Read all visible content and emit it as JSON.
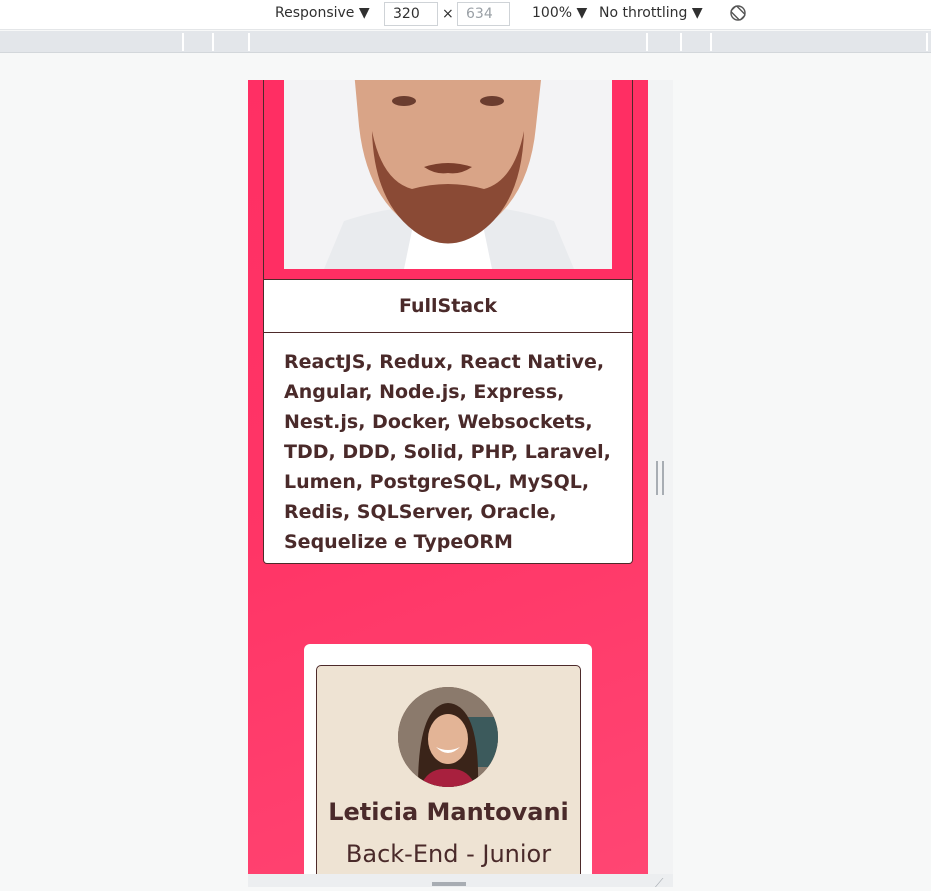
{
  "devtools": {
    "device": "Responsive",
    "width": "320",
    "height": "634",
    "zoom": "100%",
    "throttling": "No throttling"
  },
  "card1": {
    "role": "FullStack",
    "skills": "ReactJS, Redux, React Native, Angular, Node.js, Express, Nest.js, Docker, Websockets, TDD, DDD, Solid, PHP, Laravel, Lumen, PostgreSQL, MySQL, Redis, SQLServer, Oracle, Sequelize e TypeORM"
  },
  "card2": {
    "name": "Leticia Mantovani",
    "role": "Back-End - Junior"
  },
  "colors": {
    "background": "#ff2f64",
    "text": "#4a2a2a",
    "card_beige": "#eee3d3"
  }
}
